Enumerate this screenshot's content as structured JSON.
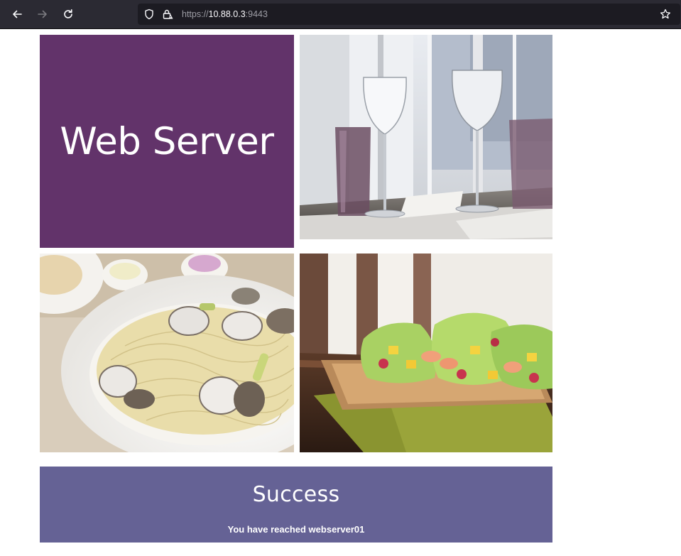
{
  "browser": {
    "url_scheme": "https://",
    "url_host": "10.88.0.3",
    "url_port": ":9443"
  },
  "page": {
    "hero_title": "Web Server",
    "banner_title": "Success",
    "banner_message": "You have reached webserver01"
  },
  "icons": {
    "back": "back-arrow-icon",
    "forward": "forward-arrow-icon",
    "reload": "reload-icon",
    "tracking_protection": "shield-icon",
    "insecure": "lock-warning-icon",
    "bookmark": "star-icon"
  },
  "colors": {
    "chrome_bg": "#2b2a33",
    "urlbar_bg": "#1c1b22",
    "hero_bg": "#62336a",
    "banner_bg": "#656295"
  }
}
